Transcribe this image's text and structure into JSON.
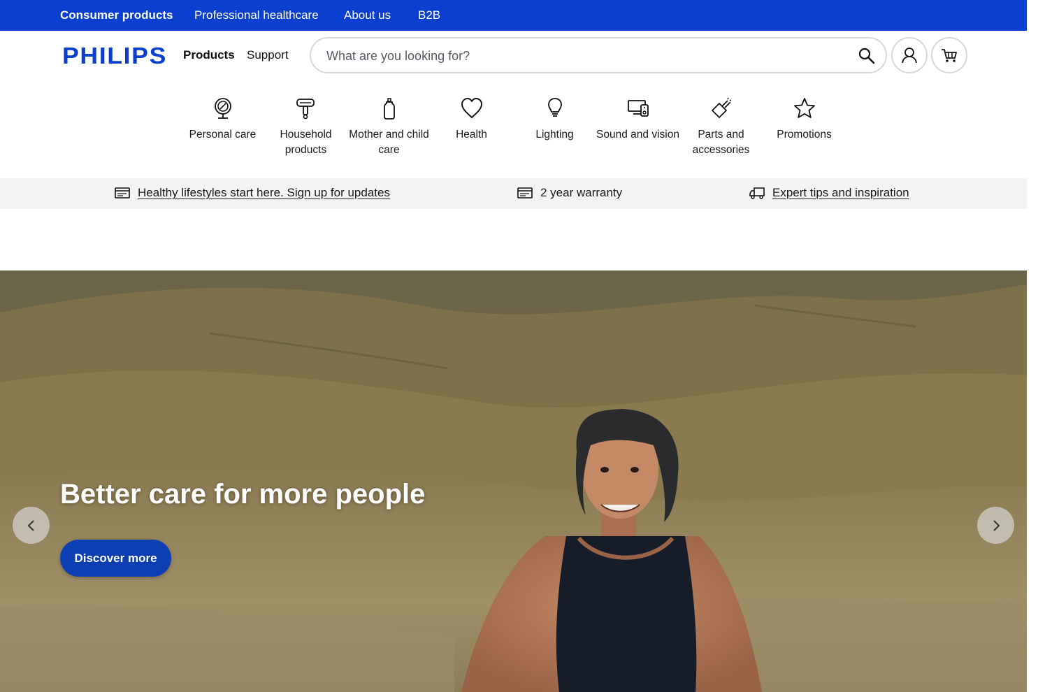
{
  "utility_nav": {
    "items": [
      {
        "label": "Consumer products",
        "active": true
      },
      {
        "label": "Professional healthcare"
      },
      {
        "label": "About us"
      },
      {
        "label": "B2B"
      }
    ]
  },
  "header": {
    "logo": "PHILIPS",
    "nav": {
      "products": "Products",
      "support": "Support"
    },
    "search": {
      "placeholder": "What are you looking for?",
      "value": ""
    },
    "icons": {
      "search": "search-icon",
      "account": "user-icon",
      "cart": "cart-icon"
    }
  },
  "categories": [
    {
      "label": "Personal care",
      "icon": "shaver-mirror-icon"
    },
    {
      "label": "Household products",
      "icon": "hair-dryer-icon"
    },
    {
      "label": "Mother and child care",
      "icon": "baby-bottle-icon"
    },
    {
      "label": "Health",
      "icon": "heart-icon"
    },
    {
      "label": "Lighting",
      "icon": "light-bulb-icon"
    },
    {
      "label": "Sound and vision",
      "icon": "devices-icon"
    },
    {
      "label": "Parts and accessories",
      "icon": "brush-head-icon"
    },
    {
      "label": "Promotions",
      "icon": "star-icon"
    }
  ],
  "usp_bar": {
    "signup": {
      "label": "Healthy lifestyles start here. Sign up for updates",
      "icon": "card-icon"
    },
    "warranty": {
      "label": "2 year warranty",
      "icon": "card-icon"
    },
    "tips": {
      "label": "Expert tips and inspiration",
      "icon": "truck-icon"
    }
  },
  "hero": {
    "title": "Better care for more people",
    "cta_label": "Discover more",
    "prev_icon": "chevron-left-icon",
    "next_icon": "chevron-right-icon"
  },
  "colors": {
    "brand_blue": "#0b3fcf",
    "cta_blue": "#0b3fb3",
    "usp_background": "#f2f3f5"
  }
}
